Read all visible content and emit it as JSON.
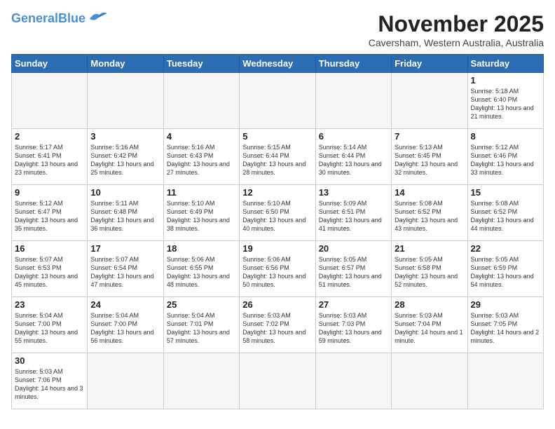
{
  "header": {
    "logo_general": "General",
    "logo_blue": "Blue",
    "month_title": "November 2025",
    "subtitle": "Caversham, Western Australia, Australia"
  },
  "weekdays": [
    "Sunday",
    "Monday",
    "Tuesday",
    "Wednesday",
    "Thursday",
    "Friday",
    "Saturday"
  ],
  "days": [
    {
      "num": "",
      "info": ""
    },
    {
      "num": "",
      "info": ""
    },
    {
      "num": "",
      "info": ""
    },
    {
      "num": "",
      "info": ""
    },
    {
      "num": "",
      "info": ""
    },
    {
      "num": "",
      "info": ""
    },
    {
      "num": "1",
      "info": "Sunrise: 5:18 AM\nSunset: 6:40 PM\nDaylight: 13 hours\nand 21 minutes."
    },
    {
      "num": "2",
      "info": "Sunrise: 5:17 AM\nSunset: 6:41 PM\nDaylight: 13 hours\nand 23 minutes."
    },
    {
      "num": "3",
      "info": "Sunrise: 5:16 AM\nSunset: 6:42 PM\nDaylight: 13 hours\nand 25 minutes."
    },
    {
      "num": "4",
      "info": "Sunrise: 5:16 AM\nSunset: 6:43 PM\nDaylight: 13 hours\nand 27 minutes."
    },
    {
      "num": "5",
      "info": "Sunrise: 5:15 AM\nSunset: 6:44 PM\nDaylight: 13 hours\nand 28 minutes."
    },
    {
      "num": "6",
      "info": "Sunrise: 5:14 AM\nSunset: 6:44 PM\nDaylight: 13 hours\nand 30 minutes."
    },
    {
      "num": "7",
      "info": "Sunrise: 5:13 AM\nSunset: 6:45 PM\nDaylight: 13 hours\nand 32 minutes."
    },
    {
      "num": "8",
      "info": "Sunrise: 5:12 AM\nSunset: 6:46 PM\nDaylight: 13 hours\nand 33 minutes."
    },
    {
      "num": "9",
      "info": "Sunrise: 5:12 AM\nSunset: 6:47 PM\nDaylight: 13 hours\nand 35 minutes."
    },
    {
      "num": "10",
      "info": "Sunrise: 5:11 AM\nSunset: 6:48 PM\nDaylight: 13 hours\nand 36 minutes."
    },
    {
      "num": "11",
      "info": "Sunrise: 5:10 AM\nSunset: 6:49 PM\nDaylight: 13 hours\nand 38 minutes."
    },
    {
      "num": "12",
      "info": "Sunrise: 5:10 AM\nSunset: 6:50 PM\nDaylight: 13 hours\nand 40 minutes."
    },
    {
      "num": "13",
      "info": "Sunrise: 5:09 AM\nSunset: 6:51 PM\nDaylight: 13 hours\nand 41 minutes."
    },
    {
      "num": "14",
      "info": "Sunrise: 5:08 AM\nSunset: 6:52 PM\nDaylight: 13 hours\nand 43 minutes."
    },
    {
      "num": "15",
      "info": "Sunrise: 5:08 AM\nSunset: 6:52 PM\nDaylight: 13 hours\nand 44 minutes."
    },
    {
      "num": "16",
      "info": "Sunrise: 5:07 AM\nSunset: 6:53 PM\nDaylight: 13 hours\nand 45 minutes."
    },
    {
      "num": "17",
      "info": "Sunrise: 5:07 AM\nSunset: 6:54 PM\nDaylight: 13 hours\nand 47 minutes."
    },
    {
      "num": "18",
      "info": "Sunrise: 5:06 AM\nSunset: 6:55 PM\nDaylight: 13 hours\nand 48 minutes."
    },
    {
      "num": "19",
      "info": "Sunrise: 5:06 AM\nSunset: 6:56 PM\nDaylight: 13 hours\nand 50 minutes."
    },
    {
      "num": "20",
      "info": "Sunrise: 5:05 AM\nSunset: 6:57 PM\nDaylight: 13 hours\nand 51 minutes."
    },
    {
      "num": "21",
      "info": "Sunrise: 5:05 AM\nSunset: 6:58 PM\nDaylight: 13 hours\nand 52 minutes."
    },
    {
      "num": "22",
      "info": "Sunrise: 5:05 AM\nSunset: 6:59 PM\nDaylight: 13 hours\nand 54 minutes."
    },
    {
      "num": "23",
      "info": "Sunrise: 5:04 AM\nSunset: 7:00 PM\nDaylight: 13 hours\nand 55 minutes."
    },
    {
      "num": "24",
      "info": "Sunrise: 5:04 AM\nSunset: 7:00 PM\nDaylight: 13 hours\nand 56 minutes."
    },
    {
      "num": "25",
      "info": "Sunrise: 5:04 AM\nSunset: 7:01 PM\nDaylight: 13 hours\nand 57 minutes."
    },
    {
      "num": "26",
      "info": "Sunrise: 5:03 AM\nSunset: 7:02 PM\nDaylight: 13 hours\nand 58 minutes."
    },
    {
      "num": "27",
      "info": "Sunrise: 5:03 AM\nSunset: 7:03 PM\nDaylight: 13 hours\nand 59 minutes."
    },
    {
      "num": "28",
      "info": "Sunrise: 5:03 AM\nSunset: 7:04 PM\nDaylight: 14 hours\nand 1 minute."
    },
    {
      "num": "29",
      "info": "Sunrise: 5:03 AM\nSunset: 7:05 PM\nDaylight: 14 hours\nand 2 minutes."
    },
    {
      "num": "30",
      "info": "Sunrise: 5:03 AM\nSunset: 7:06 PM\nDaylight: 14 hours\nand 3 minutes."
    }
  ]
}
